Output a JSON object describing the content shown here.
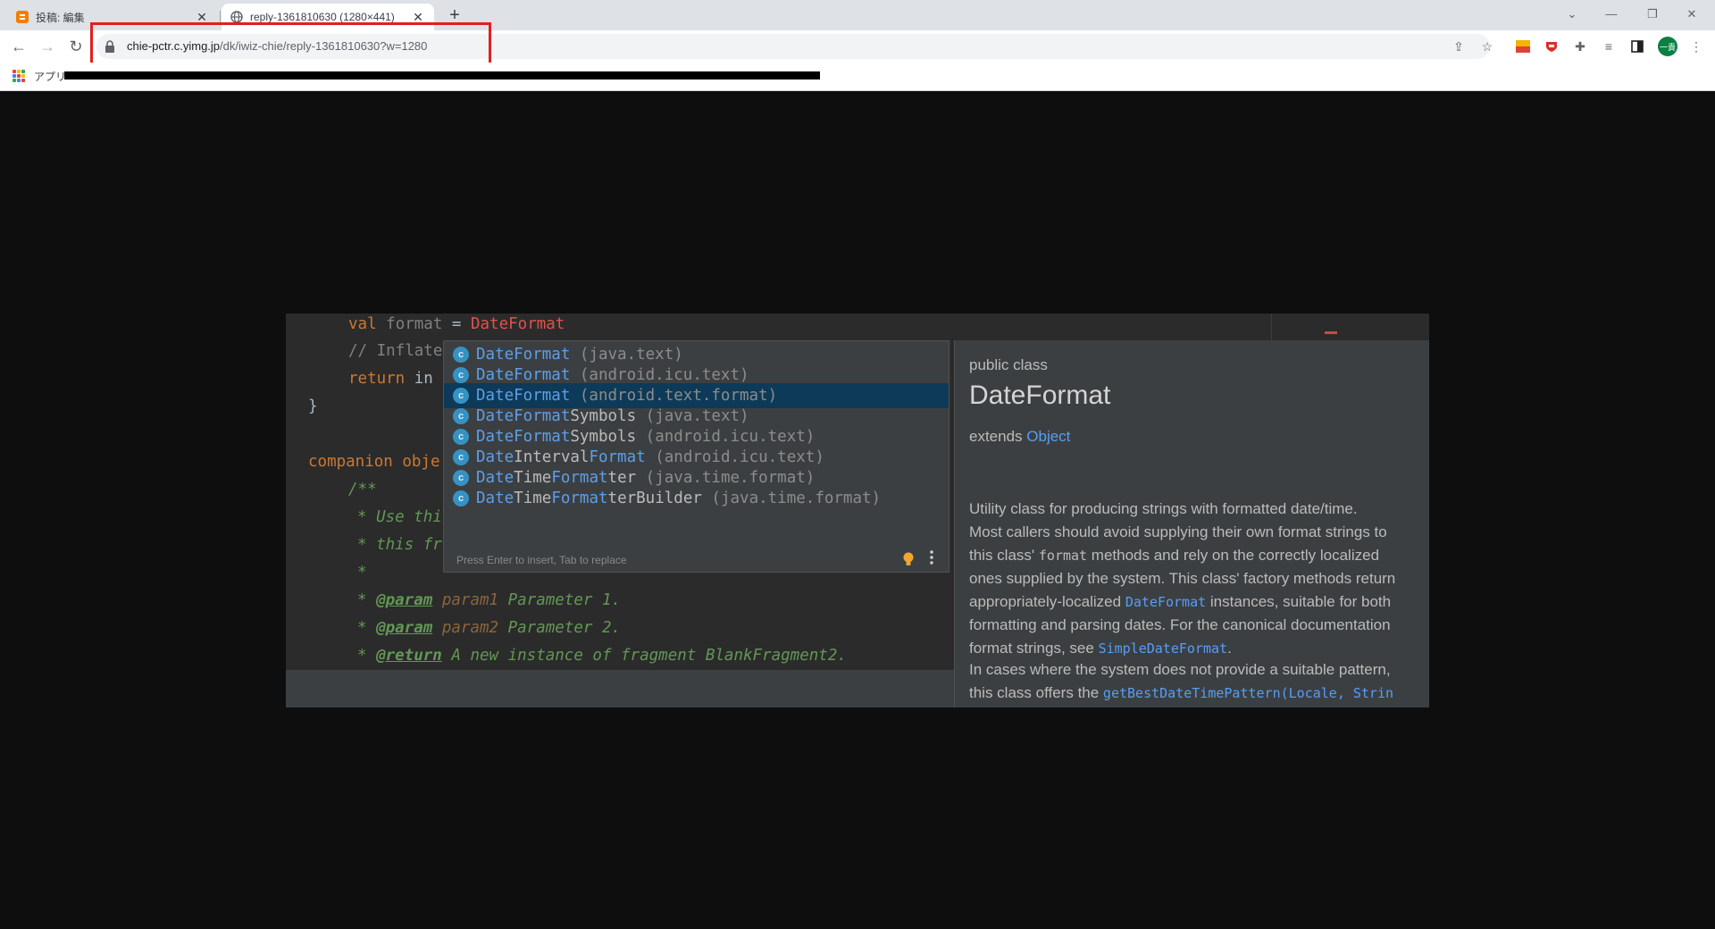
{
  "browser": {
    "tabs": [
      {
        "title": "投稿: 編集",
        "active": false
      },
      {
        "title": "reply-1361810630 (1280×441)",
        "active": true
      }
    ],
    "url_host": "chie-pctr.c.yimg.jp",
    "url_path": "/dk/iwiz-chie/reply-1361810630?w=1280",
    "bookmarks_label": "アプリ",
    "profile_initial": "一貴"
  },
  "editor": {
    "lines": {
      "l1_kw": "val ",
      "l1_name": "format",
      "l1_eq": " = ",
      "l1_err": "DateFormat",
      "l2": "// Inflate",
      "l3_kw": "return ",
      "l3_rest": "in",
      "l4": "}",
      "l5": "companion obje",
      "l6": "/**",
      "l7": "* Use thi",
      "l8": "* this fr",
      "l9": "*",
      "l10_star": "* ",
      "l10_tag": "@param",
      "l10_name": " param1",
      "l10_rest": " Parameter 1.",
      "l11_star": "* ",
      "l11_tag": "@param",
      "l11_name": " param2",
      "l11_rest": " Parameter 2.",
      "l12_star": "* ",
      "l12_tag": "@return",
      "l12_rest": " A new instance of fragment BlankFragment2."
    }
  },
  "completion": {
    "items": [
      {
        "m1": "DateFormat",
        "n1": "",
        "m2": "",
        "n2": "",
        "pkg": " (java.text)",
        "icon": "c"
      },
      {
        "m1": "DateFormat",
        "n1": "",
        "m2": "",
        "n2": "",
        "pkg": " (android.icu.text)",
        "icon": "c"
      },
      {
        "m1": "DateFormat",
        "n1": "",
        "m2": "",
        "n2": "",
        "pkg": " (android.text.format)",
        "icon": "c"
      },
      {
        "m1": "DateFormat",
        "n1": "Symbols",
        "m2": "",
        "n2": "",
        "pkg": " (java.text)",
        "icon": "c"
      },
      {
        "m1": "DateFormat",
        "n1": "Symbols",
        "m2": "",
        "n2": "",
        "pkg": " (android.icu.text)",
        "icon": "c"
      },
      {
        "m1": "Date",
        "n1": "Interval",
        "m2": "Format",
        "n2": "",
        "pkg": " (android.icu.text)",
        "icon": "c"
      },
      {
        "m1": "Date",
        "n1": "Time",
        "m2": "Format",
        "n2": "ter",
        "pkg": " (java.time.format)",
        "icon": "c"
      },
      {
        "m1": "Date",
        "n1": "Time",
        "m2": "Format",
        "n2": "terBuilder",
        "pkg": " (java.time.format)",
        "icon": "c"
      }
    ],
    "selected_index": 2,
    "footer": "Press Enter to insert, Tab to replace"
  },
  "documentation": {
    "modifier": "public class",
    "title": "DateFormat",
    "extends_label": "extends ",
    "extends_link": "Object",
    "p1": "Utility class for producing strings with formatted date/time.",
    "p2_l1": "Most callers should avoid supplying their own format strings to",
    "p2_l2a": "this class' ",
    "p2_l2code": "format",
    "p2_l2b": " methods and rely on the correctly localized",
    "p2_l3": "ones supplied by the system. This class' factory methods return",
    "p2_l4a": "appropriately-localized ",
    "p2_l4link": "DateFormat",
    "p2_l4b": " instances, suitable for both",
    "p2_l5": "formatting and parsing dates. For the canonical documentation",
    "p2_l6a": "format strings, see ",
    "p2_l6link": "SimpleDateFormat",
    "p2_l6b": ".",
    "p3_l1": "In cases where the system does not provide a suitable pattern,",
    "p3_l2a": "this class offers the ",
    "p3_l2link": "getBestDateTimePattern(Locale, Strin"
  },
  "colors": {
    "highlight_box": "#e0201f",
    "selection": "#0d3a58",
    "match": "#5d9fe9",
    "error": "#e0524b",
    "keyword": "#cc7832",
    "doc_comment": "#629755"
  }
}
